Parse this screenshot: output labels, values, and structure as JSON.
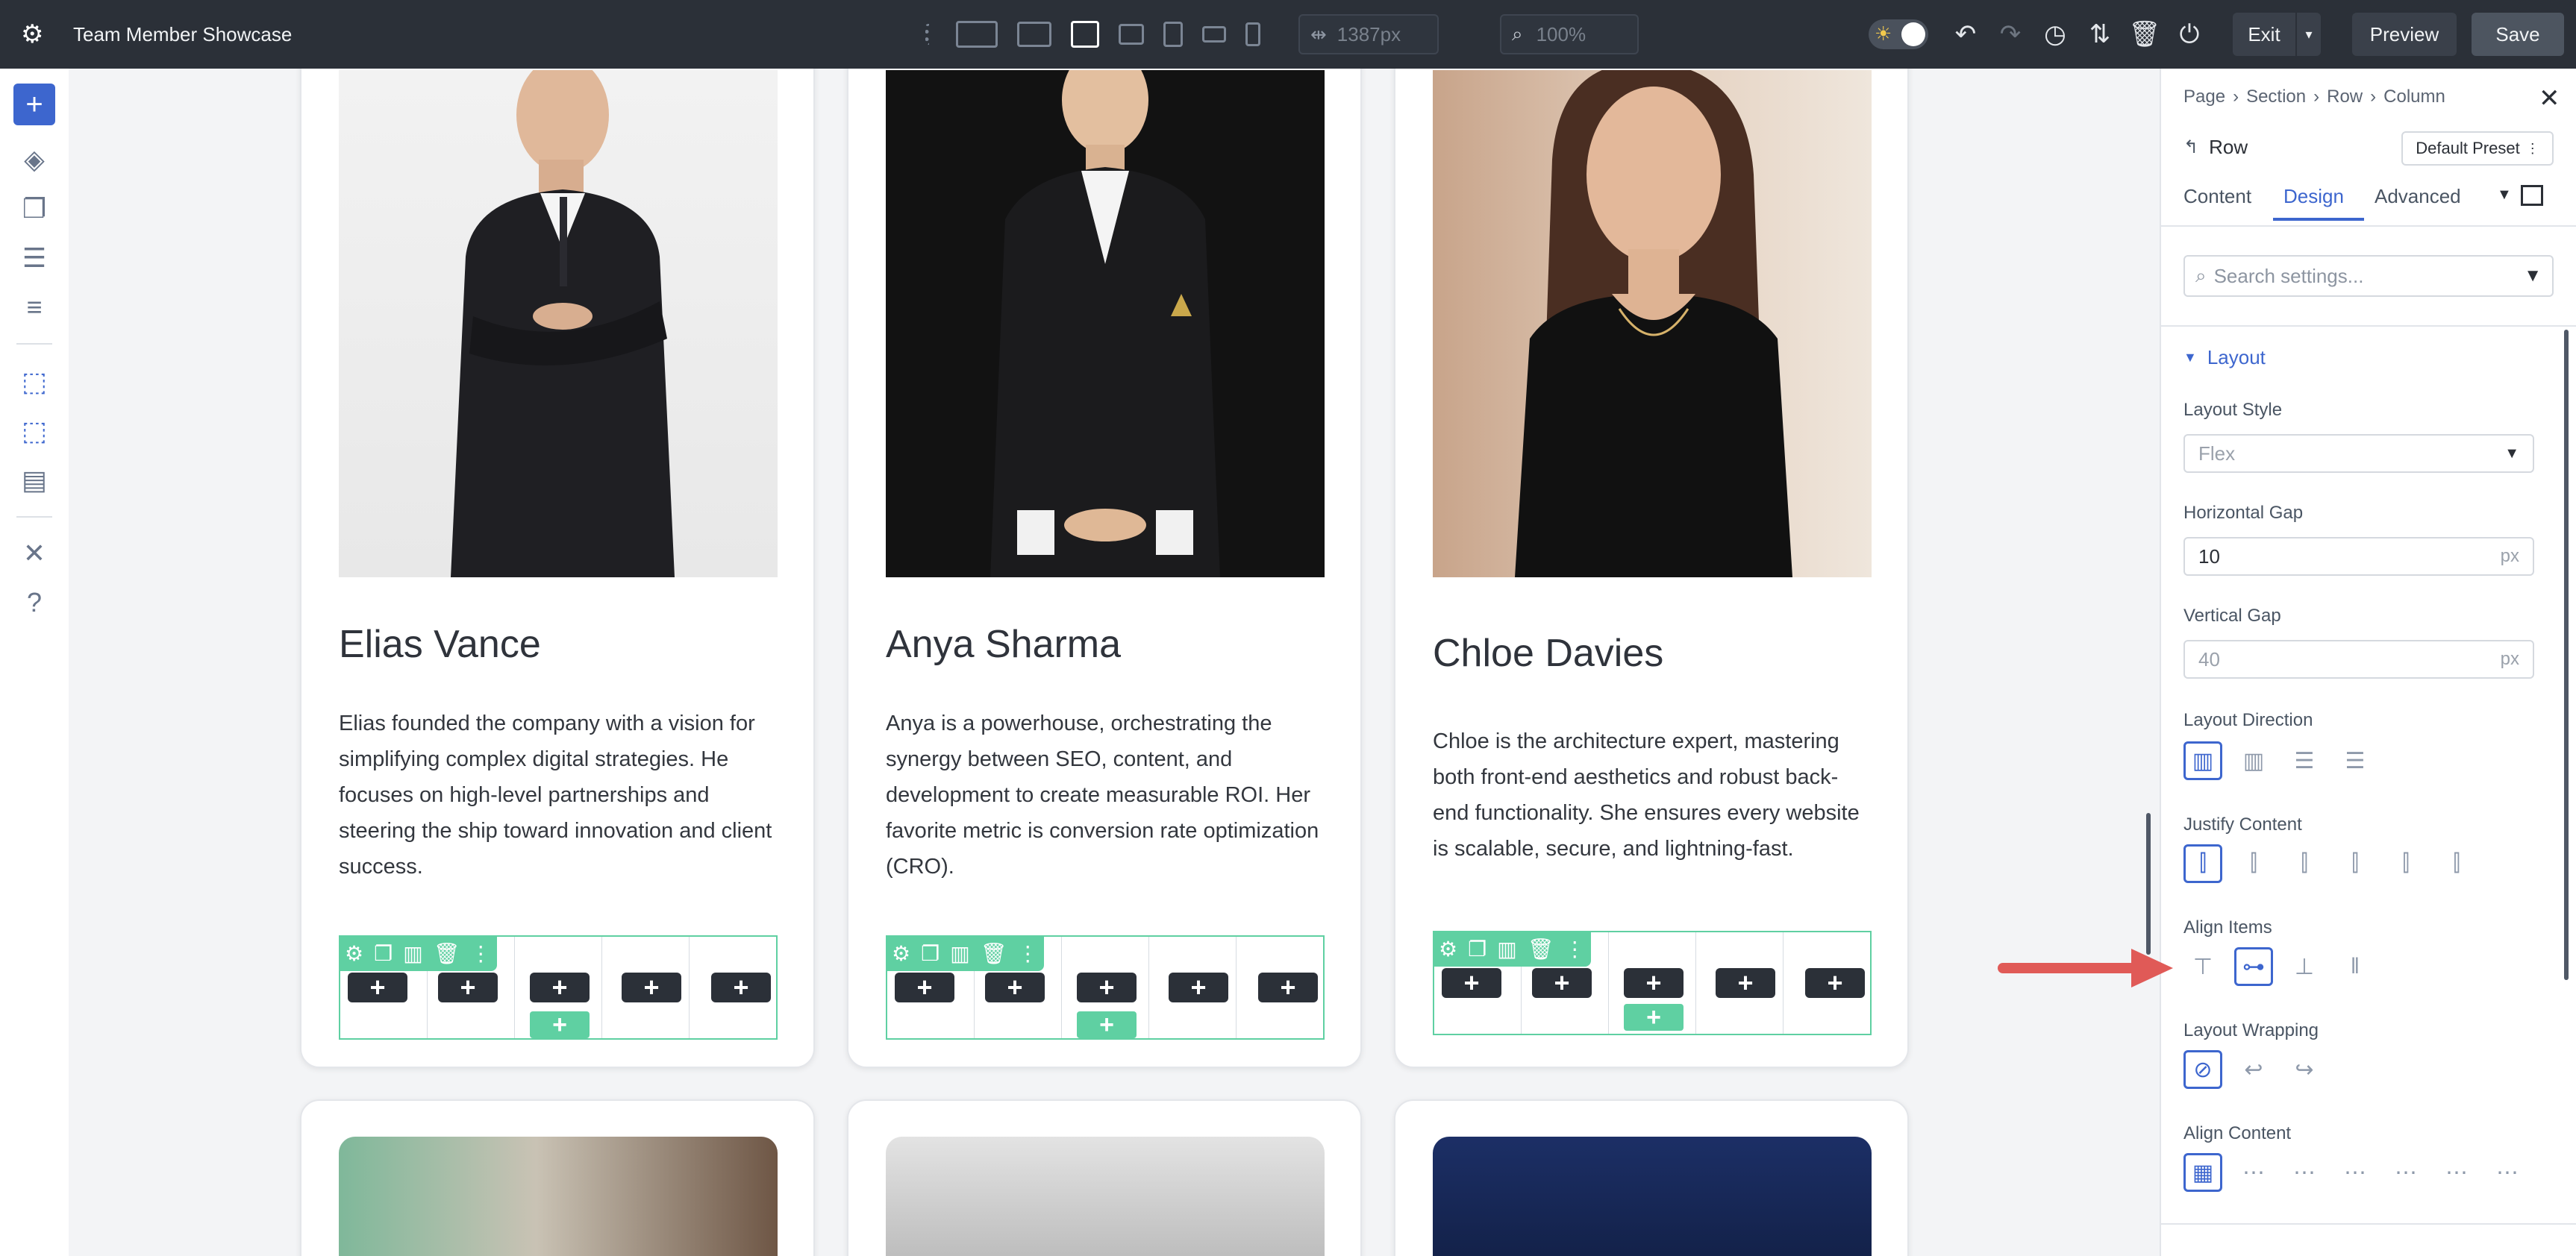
{
  "app": {
    "title": "Team Member Showcase",
    "width_readout": "1387px",
    "zoom_readout": "100%",
    "exit_label": "Exit",
    "preview_label": "Preview",
    "save_label": "Save"
  },
  "members": [
    {
      "name": "Elias Vance",
      "bio": "Elias founded the company with a vision for simplifying complex digital strategies. He focuses on high-level partnerships and steering the ship toward innovation and client success."
    },
    {
      "name": "Anya Sharma",
      "bio": "Anya is a powerhouse, orchestrating the synergy between SEO, content, and development to create measurable ROI. Her favorite metric is conversion rate optimization (CRO)."
    },
    {
      "name": "Chloe Davies",
      "bio": "Chloe is the architecture expert, mastering both front-end aesthetics and robust back-end functionality. She ensures every website is scalable, secure, and lightning-fast."
    }
  ],
  "panel": {
    "breadcrumb": [
      "Page",
      "Section",
      "Row",
      "Column"
    ],
    "element_label": "Row",
    "preset_label": "Default Preset",
    "tabs": [
      "Content",
      "Design",
      "Advanced"
    ],
    "active_tab": "Design",
    "search_placeholder": "Search settings...",
    "section_label": "Layout",
    "layout_style_label": "Layout Style",
    "layout_style_value": "Flex",
    "horizontal_gap_label": "Horizontal Gap",
    "horizontal_gap_value": "10",
    "horizontal_gap_unit": "px",
    "vertical_gap_label": "Vertical Gap",
    "vertical_gap_placeholder": "40",
    "vertical_gap_unit": "px",
    "layout_direction_label": "Layout Direction",
    "justify_content_label": "Justify Content",
    "align_items_label": "Align Items",
    "layout_wrapping_label": "Layout Wrapping",
    "align_content_label": "Align Content"
  },
  "colors": {
    "accent": "#3d66ce",
    "row_guide": "#5fd0a2",
    "topbar": "#2b3038",
    "arrow": "#e05a57"
  }
}
